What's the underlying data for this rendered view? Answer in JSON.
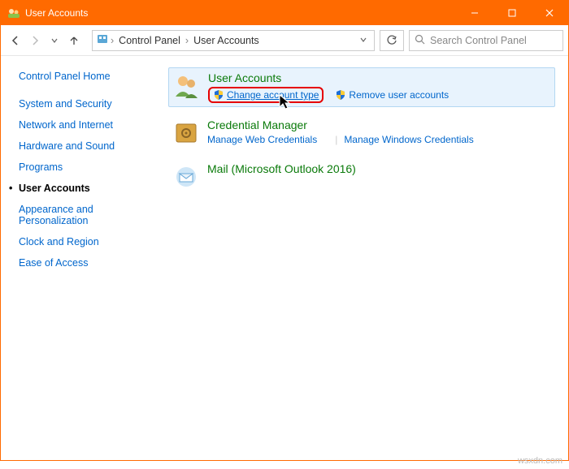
{
  "window": {
    "title": "User Accounts"
  },
  "toolbar": {
    "breadcrumbs": {
      "root_icon": "control-panel",
      "item1": "Control Panel",
      "item2": "User Accounts"
    },
    "search_placeholder": "Search Control Panel"
  },
  "sidebar": {
    "home": "Control Panel Home",
    "items": [
      "System and Security",
      "Network and Internet",
      "Hardware and Sound",
      "Programs",
      "User Accounts",
      "Appearance and Personalization",
      "Clock and Region",
      "Ease of Access"
    ],
    "active_index": 4
  },
  "main": {
    "categories": [
      {
        "title": "User Accounts",
        "highlighted": true,
        "icon": "users",
        "tasks": [
          {
            "label": "Change account type",
            "shield": true,
            "circled": true
          },
          {
            "label": "Remove user accounts",
            "shield": true
          }
        ]
      },
      {
        "title": "Credential Manager",
        "icon": "safe",
        "tasks": [
          {
            "label": "Manage Web Credentials"
          },
          {
            "label": "Manage Windows Credentials",
            "divider_before": true
          }
        ]
      },
      {
        "title": "Mail (Microsoft Outlook 2016)",
        "icon": "mail",
        "tasks": []
      }
    ]
  },
  "watermark": "wsxdn.com"
}
